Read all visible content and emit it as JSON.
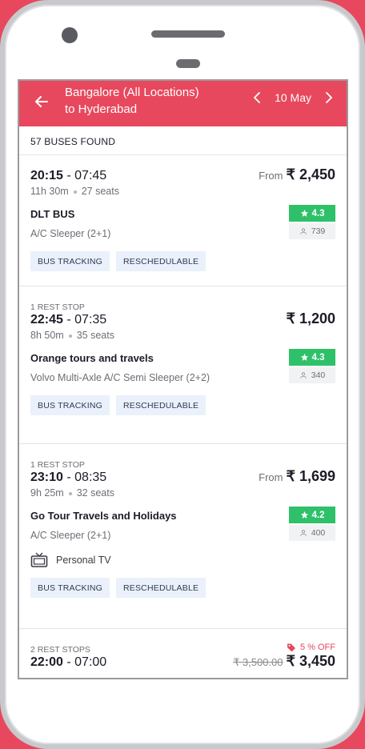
{
  "header": {
    "route_line1": "Bangalore (All Locations)",
    "route_line2": "to Hyderabad",
    "date": "10 May"
  },
  "results": {
    "count_label": "57 BUSES FOUND"
  },
  "buses": [
    {
      "stops": "",
      "depart": "20:15",
      "arrive": "07:45",
      "duration": "11h 30m",
      "seats": "27 seats",
      "from": "From",
      "price": "₹ 2,450",
      "operator": "DLT BUS",
      "bus_type": "A/C Sleeper (2+1)",
      "rating": "4.3",
      "rating_count": "739",
      "tags": [
        "BUS TRACKING",
        "RESCHEDULABLE"
      ]
    },
    {
      "stops": "1 REST STOP",
      "depart": "22:45",
      "arrive": "07:35",
      "duration": "8h 50m",
      "seats": "35 seats",
      "from": "",
      "price": "₹ 1,200",
      "operator": "Orange tours and travels",
      "bus_type": "Volvo Multi-Axle A/C Semi Sleeper (2+2)",
      "rating": "4.3",
      "rating_count": "340",
      "tags": [
        "BUS TRACKING",
        "RESCHEDULABLE"
      ]
    },
    {
      "stops": "1 REST STOP",
      "depart": "23:10",
      "arrive": "08:35",
      "duration": "9h 25m",
      "seats": "32 seats",
      "from": "From",
      "price": "₹ 1,699",
      "operator": "Go Tour Travels and Holidays",
      "bus_type": "A/C Sleeper (2+1)",
      "rating": "4.2",
      "rating_count": "400",
      "amenity": "Personal TV",
      "tags": [
        "BUS TRACKING",
        "RESCHEDULABLE"
      ]
    },
    {
      "stops": "2 REST STOPS",
      "offer": "5 % OFF",
      "depart": "22:00",
      "arrive": "07:00",
      "original_price": "₹ 3,500.00",
      "price": "₹ 3,450"
    }
  ],
  "colors": {
    "brand": "#e8485d",
    "rating": "#2ec16a",
    "tag_bg": "#eaf1fb"
  }
}
